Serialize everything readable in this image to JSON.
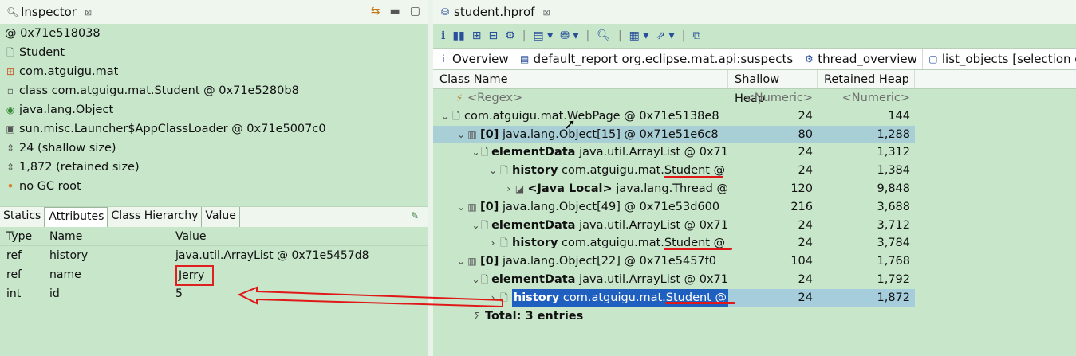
{
  "inspector": {
    "tab_title": "Inspector",
    "close_glyph": "⊠",
    "lines": [
      {
        "icon": "at-icon",
        "glyph": "",
        "text": "@ 0x71e518038"
      },
      {
        "icon": "class-file-icon",
        "glyph": "🗋",
        "text": "Student"
      },
      {
        "icon": "package-icon",
        "glyph": "⊞",
        "text": "com.atguigu.mat"
      },
      {
        "icon": "class-icon",
        "glyph": "▫",
        "text": "class com.atguigu.mat.Student @ 0x71e5280b8"
      },
      {
        "icon": "superclass-icon",
        "glyph": "◉",
        "text": "java.lang.Object"
      },
      {
        "icon": "classloader-icon",
        "glyph": "▣",
        "text": "sun.misc.Launcher$AppClassLoader @ 0x71e5007c0"
      },
      {
        "icon": "size-icon",
        "glyph": "⇕",
        "text": "24 (shallow size)"
      },
      {
        "icon": "size-icon",
        "glyph": "⇕",
        "text": "1,872 (retained size)"
      },
      {
        "icon": "gc-root-icon",
        "glyph": "•",
        "text": "no GC root"
      }
    ],
    "subtabs": [
      "Statics",
      "Attributes",
      "Class Hierarchy",
      "Value"
    ],
    "active_subtab": "Attributes",
    "columns": [
      "Type",
      "Name",
      "Value"
    ],
    "rows": [
      {
        "type": "ref",
        "name": "history",
        "value": "java.util.ArrayList @ 0x71e5457d8"
      },
      {
        "type": "ref",
        "name": "name",
        "value": "Jerry"
      },
      {
        "type": "int",
        "name": "id",
        "value": "5"
      }
    ]
  },
  "editor": {
    "tab_title": "student.hprof",
    "close_glyph": "⊠",
    "view_tabs": [
      {
        "icon": "info-icon",
        "glyph": "i",
        "label": "Overview"
      },
      {
        "icon": "report-icon",
        "glyph": "▤",
        "label": "default_report  org.eclipse.mat.api:suspects"
      },
      {
        "icon": "thread-icon",
        "glyph": "⚙",
        "label": "thread_overview"
      },
      {
        "icon": "list-icon",
        "glyph": "▢",
        "label": "list_objects  [selection of '"
      }
    ],
    "columns": [
      "Class Name",
      "Shallow Heap",
      "Retained Heap"
    ],
    "filter_row": {
      "name": "<Regex>",
      "shallow": "<Numeric>",
      "retained": "<Numeric>"
    },
    "rows": [
      {
        "indent": 0,
        "tw": "⌄",
        "bold": "",
        "text": "com.atguigu.mat.WebPage @ 0x71e5138e8",
        "shallow": "24",
        "retained": "144"
      },
      {
        "indent": 1,
        "tw": "⌄",
        "bold": "[0]",
        "text": "java.lang.Object[15] @ 0x71e51e6c8",
        "shallow": "80",
        "retained": "1,288"
      },
      {
        "indent": 2,
        "tw": "⌄",
        "bold": "elementData",
        "text": "java.util.ArrayList @ 0x71",
        "shallow": "24",
        "retained": "1,312"
      },
      {
        "indent": 3,
        "tw": "⌄",
        "bold": "history",
        "text": "com.atguigu.mat.Student @",
        "shallow": "24",
        "retained": "1,384"
      },
      {
        "indent": 4,
        "tw": "›",
        "bold": "<Java Local>",
        "text": "java.lang.Thread @",
        "shallow": "120",
        "retained": "9,848"
      },
      {
        "indent": 1,
        "tw": "⌄",
        "bold": "[0]",
        "text": "java.lang.Object[49] @ 0x71e53d600",
        "shallow": "216",
        "retained": "3,688"
      },
      {
        "indent": 2,
        "tw": "⌄",
        "bold": "elementData",
        "text": "java.util.ArrayList @ 0x71",
        "shallow": "24",
        "retained": "3,712"
      },
      {
        "indent": 3,
        "tw": "›",
        "bold": "history",
        "text": "com.atguigu.mat.Student @",
        "shallow": "24",
        "retained": "3,784"
      },
      {
        "indent": 1,
        "tw": "⌄",
        "bold": "[0]",
        "text": "java.lang.Object[22] @ 0x71e5457f0",
        "shallow": "104",
        "retained": "1,768"
      },
      {
        "indent": 2,
        "tw": "⌄",
        "bold": "elementData",
        "text": "java.util.ArrayList @ 0x71",
        "shallow": "24",
        "retained": "1,792"
      },
      {
        "indent": 3,
        "tw": "›",
        "bold": "history",
        "text": "com.atguigu.mat.Student @",
        "shallow": "24",
        "retained": "1,872"
      }
    ],
    "total_label": "Total: 3 entries"
  },
  "colors": {
    "annotation_red": "#e01818",
    "selection_blue": "#1f5fbf"
  }
}
